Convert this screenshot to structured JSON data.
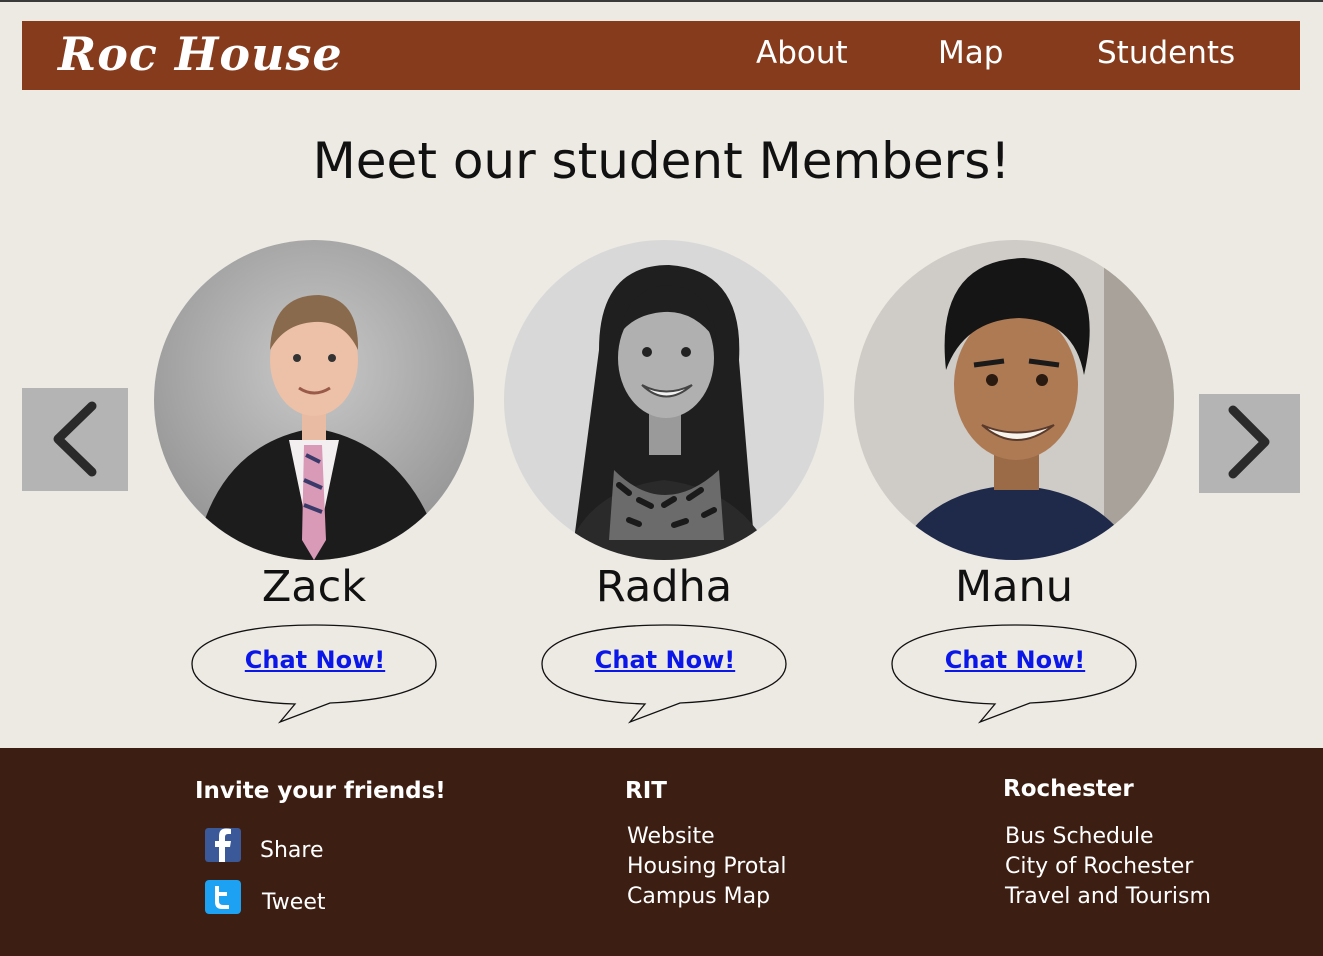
{
  "header": {
    "logo": "Roc House",
    "nav": [
      "About",
      "Map",
      "Students"
    ]
  },
  "main": {
    "headline": "Meet our student Members!",
    "carousel": {
      "prev_icon": "chevron-left-icon",
      "next_icon": "chevron-right-icon"
    },
    "members": [
      {
        "name": "Zack",
        "chat_label": "Chat Now!"
      },
      {
        "name": "Radha",
        "chat_label": "Chat Now!"
      },
      {
        "name": "Manu",
        "chat_label": "Chat Now!"
      }
    ]
  },
  "footer": {
    "invite": {
      "heading": "Invite your friends!",
      "share_label": "Share",
      "share_icon": "facebook-icon",
      "tweet_label": "Tweet",
      "tweet_icon": "twitter-icon"
    },
    "rit": {
      "heading": "RIT",
      "links": [
        "Website",
        "Housing Protal",
        "Campus Map"
      ]
    },
    "rochester": {
      "heading": "Rochester",
      "links": [
        "Bus Schedule",
        "City of Rochester",
        "Travel and Tourism"
      ]
    }
  },
  "colors": {
    "header_bg": "#863b1c",
    "page_bg": "#ede9e3",
    "footer_bg": "#3d1e13",
    "link_blue": "#0b17e8",
    "arrow_bg": "#b4b4b4",
    "facebook": "#3b5998",
    "twitter": "#1da1f2"
  }
}
